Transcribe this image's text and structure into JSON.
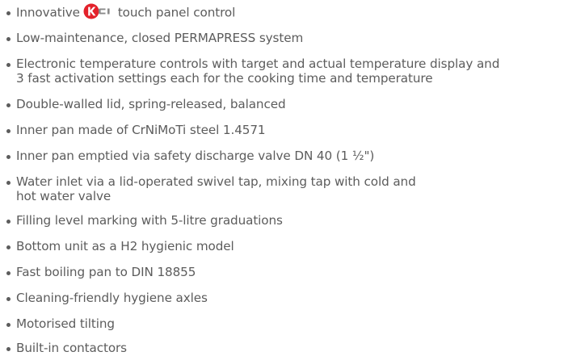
{
  "features": [
    {
      "text": "Innovative",
      "text_after": "touch panel control",
      "logo": "kc-logo-icon"
    },
    {
      "text": "Low-maintenance, closed PERMAPRESS system"
    },
    {
      "line1": "Electronic temperature controls with target and actual temperature display and",
      "line2": "3 fast activation settings each for the cooking time and temperature"
    },
    {
      "text": "Double-walled lid, spring-released, balanced"
    },
    {
      "text": "Inner pan made of CrNiMoTi steel 1.4571"
    },
    {
      "text": "Inner pan emptied via safety discharge valve DN 40 (1 ½\")"
    },
    {
      "line1": "Water inlet via a lid-operated swivel tap, mixing tap with cold and",
      "line2": "hot water valve"
    },
    {
      "text": "Filling level marking with 5-litre graduations"
    },
    {
      "text": "Bottom unit as a H2 hygienic model"
    },
    {
      "text": "Fast boiling pan to DIN 18855"
    },
    {
      "text": "Cleaning-friendly hygiene axles"
    },
    {
      "text": "Motorised tilting"
    },
    {
      "text": "Built-in contactors"
    }
  ],
  "colors": {
    "text": "#5c5c5c",
    "logo_red": "#e3222b",
    "logo_grey": "#8a8a8a"
  }
}
